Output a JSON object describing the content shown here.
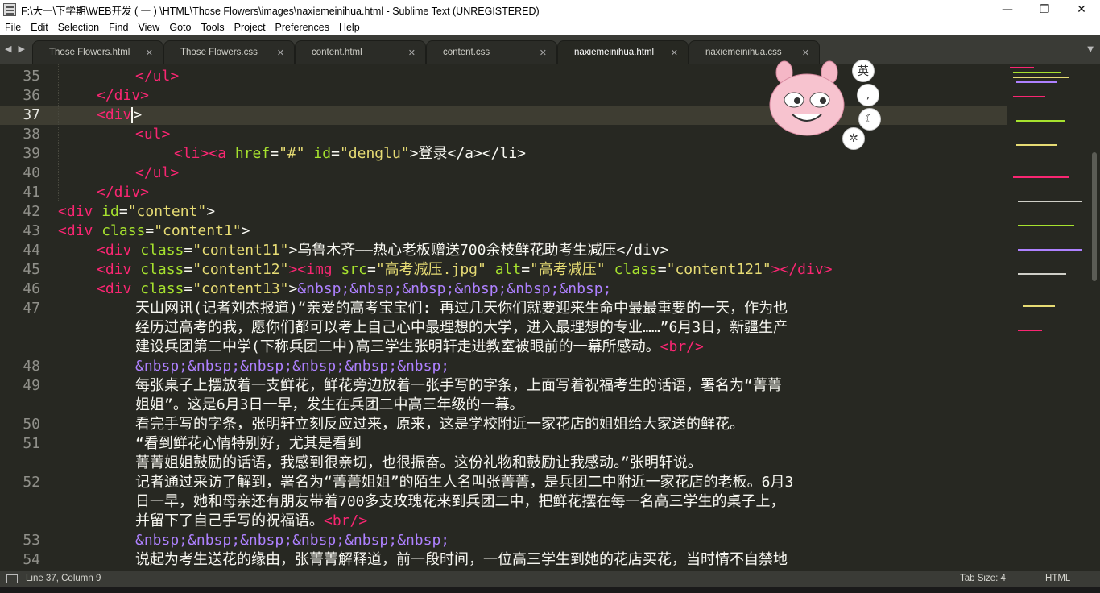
{
  "window": {
    "title": "F:\\大一\\下学期\\WEB开发 ( 一 ) \\HTML\\Those Flowers\\images\\naxiemeinihua.html - Sublime Text (UNREGISTERED)",
    "minimize": "—",
    "maximize": "❐",
    "close": "✕"
  },
  "menu": [
    "File",
    "Edit",
    "Selection",
    "Find",
    "View",
    "Goto",
    "Tools",
    "Project",
    "Preferences",
    "Help"
  ],
  "tabs": [
    {
      "label": "Those Flowers.html",
      "active": false
    },
    {
      "label": "Those Flowers.css",
      "active": false
    },
    {
      "label": "content.html",
      "active": false
    },
    {
      "label": "content.css",
      "active": false
    },
    {
      "label": "naxiemeinihua.html",
      "active": true
    },
    {
      "label": "naxiemeinihua.css",
      "active": false
    }
  ],
  "editor": {
    "current_line": 37,
    "line_numbers": [
      "35",
      "36",
      "37",
      "38",
      "39",
      "40",
      "41",
      "42",
      "43",
      "44",
      "45",
      "46",
      "47",
      "",
      "",
      "48",
      "49",
      "",
      "50",
      "51",
      "",
      "52",
      "",
      "",
      "53",
      "54"
    ],
    "lines": {
      "l35_tag": "</ul>",
      "l36_tag": "</div>",
      "l37_open": "<div",
      "l37_close": ">",
      "l38_tag": "<ul>",
      "l39_a": "<li><a ",
      "l39_attr1": "href",
      "l39_eq1": "=",
      "l39_val1": "\"#\"",
      "l39_attr2": " id",
      "l39_eq2": "=",
      "l39_val2": "\"denglu\"",
      "l39_text": ">登录</a></li>",
      "l40_tag": "</ul>",
      "l41_tag": "</div>",
      "l42_tag": "<div ",
      "l42_attr": "id",
      "l42_eq": "=",
      "l42_val": "\"content\"",
      "l42_end": ">",
      "l43_tag": "<div ",
      "l43_attr": "class",
      "l43_eq": "=",
      "l43_val": "\"content1\"",
      "l43_end": ">",
      "l44_tag": "<div ",
      "l44_attr": "class",
      "l44_eq": "=",
      "l44_val": "\"content11\"",
      "l44_text": ">乌鲁木齐——热心老板赠送700余枝鲜花助考生减压</div>",
      "l45_tag": "<div ",
      "l45_attr": "class",
      "l45_eq": "=",
      "l45_val": "\"content12\"",
      "l45_img": "><img ",
      "l45_attr2": "src",
      "l45_val2": "\"高考减压.jpg\"",
      "l45_attr3": " alt",
      "l45_val3": "\"高考减压\"",
      "l45_attr4": " class",
      "l45_val4": "\"content121\"",
      "l45_end": "></div>",
      "l46_tag": "<div ",
      "l46_attr": "class",
      "l46_eq": "=",
      "l46_val": "\"content13\"",
      "l46_gt": ">",
      "l46_ent": "&nbsp;&nbsp;&nbsp;&nbsp;&nbsp;&nbsp;",
      "l47a": "天山网讯(记者刘杰报道)“亲爱的高考宝宝们: 再过几天你们就要迎来生命中最最重要的一天，作为也",
      "l47b": "经历过高考的我，愿你们都可以考上自己心中最理想的大学，进入最理想的专业……”6月3日，新疆生产",
      "l47c": "建设兵团第二中学(下称兵团二中)高三学生张明轩走进教室被眼前的一幕所感动。",
      "l47c_br": "<br/>",
      "l48_ent": "&nbsp;&nbsp;&nbsp;&nbsp;&nbsp;&nbsp;",
      "l49a": "每张桌子上摆放着一支鲜花，鲜花旁边放着一张手写的字条，上面写着祝福考生的话语，署名为“菁菁",
      "l49b": "姐姐”。这是6月3日一早，发生在兵团二中高三年级的一幕。",
      "l50": "看完手写的字条，张明轩立刻反应过来，原来，这是学校附近一家花店的姐姐给大家送的鲜花。",
      "l51a": "“看到鲜花心情特别好，尤其是看到",
      "l51b": "菁菁姐姐鼓励的话语，我感到很亲切，也很振奋。这份礼物和鼓励让我感动。”张明轩说。",
      "l52a": "记者通过采访了解到，署名为“菁菁姐姐”的陌生人名叫张菁菁，是兵团二中附近一家花店的老板。6月3",
      "l52b": "日一早，她和母亲还有朋友带着700多支玫瑰花来到兵团二中，把鲜花摆在每一名高三学生的桌子上，",
      "l52c": "并留下了自己手写的祝福语。",
      "l52c_br": "<br/>",
      "l53_ent": "&nbsp;&nbsp;&nbsp;&nbsp;&nbsp;&nbsp;",
      "l54": "说起为考生送花的缘由，张菁菁解释道，前一段时间，一位高三学生到她的花店买花，当时情不自禁地"
    }
  },
  "ime": {
    "lang_label": "英"
  },
  "status": {
    "position": "Line 37, Column 9",
    "tab_size": "Tab Size: 4",
    "syntax": "HTML"
  },
  "colors": {
    "background": "#272822",
    "tag": "#f92672",
    "attribute": "#a6e22e",
    "string": "#e6db74",
    "entity": "#ae81ff"
  }
}
